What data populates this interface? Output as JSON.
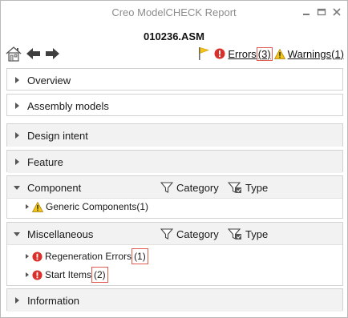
{
  "window": {
    "title": "Creo ModelCHECK Report"
  },
  "report": {
    "model_name": "010236.ASM"
  },
  "status": {
    "errors_label": "Errors",
    "errors_count": "(3)",
    "warnings_label": "Warnings",
    "warnings_count": "(1)"
  },
  "sections": {
    "overview": "Overview",
    "assembly_models": "Assembly models",
    "design_intent": "Design intent",
    "feature": "Feature",
    "component": {
      "label": "Component",
      "category_label": "Category",
      "type_label": "Type",
      "items": [
        {
          "label": "Generic Components",
          "count": "(1)",
          "severity": "warning"
        }
      ]
    },
    "miscellaneous": {
      "label": "Miscellaneous",
      "category_label": "Category",
      "type_label": "Type",
      "items": [
        {
          "label": "Regeneration Errors",
          "count": "(1)",
          "severity": "error"
        },
        {
          "label": "Start Items",
          "count": "(2)",
          "severity": "error"
        }
      ]
    },
    "information": "Information"
  },
  "colors": {
    "error_red": "#d9302b",
    "warning_yellow": "#f2c318",
    "highlight_box": "#e05a4f",
    "flag_yellow": "#f3c31b"
  }
}
